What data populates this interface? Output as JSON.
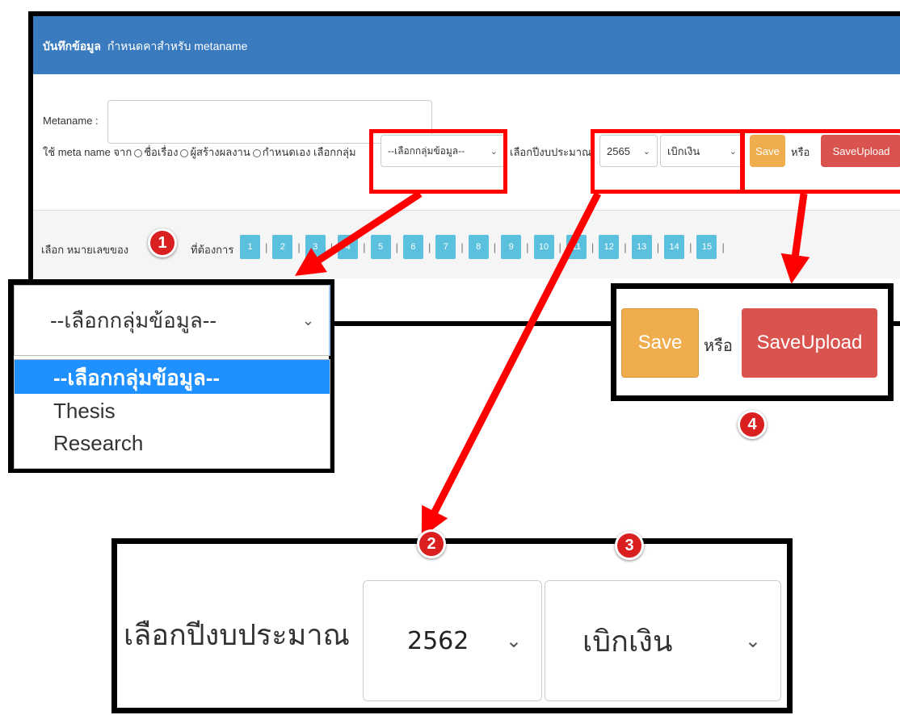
{
  "panel": {
    "title_bold": "บันทึกข้อมูล",
    "title_rest": "กำหนดคาสำหรับ metaname",
    "metaname_label": "Metaname :",
    "metaname_value": "",
    "use_meta_label": "ใช้ meta name จาก",
    "radio_options": [
      "ชื่อเรื่อง",
      "ผู้สร้างผลงาน",
      "กำหนดเอง"
    ],
    "group_label": "เลือกกลุ่ม",
    "group_select_value": "--เลือกกลุ่มข้อมูล--",
    "budget_label": "เลือกปีงบประมาณ",
    "year_value": "2565",
    "type_value": "เบิกเงิน",
    "save_label": "Save",
    "or_label": "หรือ",
    "saveupload_label": "SaveUpload",
    "pager_label_start": "เลือก หมายเลขของ",
    "pager_label_end": "ที่ต้องการ",
    "pages": [
      "1",
      "2",
      "3",
      "4",
      "5",
      "6",
      "7",
      "8",
      "9",
      "10",
      "11",
      "12",
      "13",
      "14",
      "15"
    ]
  },
  "callouts": {
    "group_dropdown": {
      "selected": "--เลือกกลุ่มข้อมูล--",
      "options": [
        "--เลือกกลุ่มข้อมูล--",
        "Thesis",
        "Research"
      ]
    },
    "buttons": {
      "save_label": "Save",
      "or_label": "หรือ",
      "saveupload_label": "SaveUpload"
    },
    "budget": {
      "label": "เลือกปีงบประมาณ",
      "year_value": "2562",
      "type_value": "เบิกเงิน"
    }
  },
  "badges": [
    "1",
    "2",
    "3",
    "4"
  ],
  "colors": {
    "header": "#3a7bbf",
    "save": "#f0ad4e",
    "saveupload": "#d9534f",
    "page": "#5bc0de",
    "highlight": "#ff0000",
    "selected_option": "#1e90ff"
  },
  "icons": {
    "chevron": "chevron-down-icon",
    "arrow": "red-arrow"
  }
}
